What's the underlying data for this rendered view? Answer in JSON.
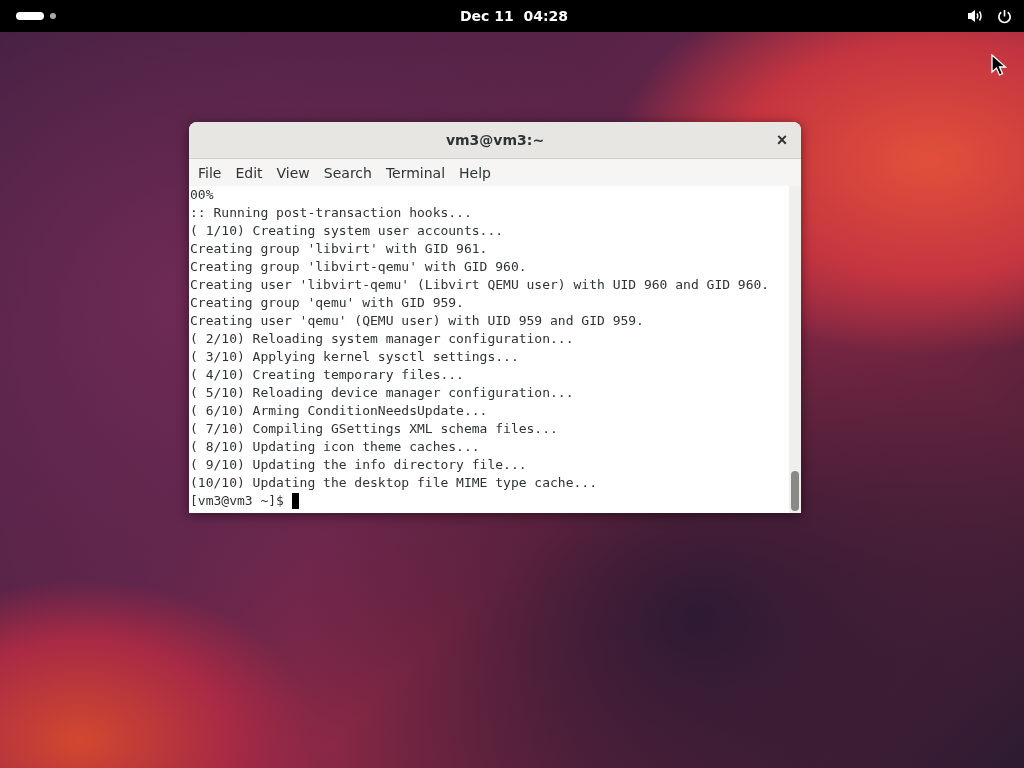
{
  "top_bar": {
    "clock": "Dec 11  04:28"
  },
  "window": {
    "title": "vm3@vm3:~",
    "close": "×",
    "menu": [
      "File",
      "Edit",
      "View",
      "Search",
      "Terminal",
      "Help"
    ],
    "terminal_lines": [
      "00%",
      ":: Running post-transaction hooks...",
      "( 1/10) Creating system user accounts...",
      "Creating group 'libvirt' with GID 961.",
      "Creating group 'libvirt-qemu' with GID 960.",
      "Creating user 'libvirt-qemu' (Libvirt QEMU user) with UID 960 and GID 960.",
      "Creating group 'qemu' with GID 959.",
      "Creating user 'qemu' (QEMU user) with UID 959 and GID 959.",
      "( 2/10) Reloading system manager configuration...",
      "( 3/10) Applying kernel sysctl settings...",
      "( 4/10) Creating temporary files...",
      "( 5/10) Reloading device manager configuration...",
      "( 6/10) Arming ConditionNeedsUpdate...",
      "( 7/10) Compiling GSettings XML schema files...",
      "( 8/10) Updating icon theme caches...",
      "( 9/10) Updating the info directory file...",
      "(10/10) Updating the desktop file MIME type cache..."
    ],
    "prompt": "[vm3@vm3 ~]$"
  }
}
